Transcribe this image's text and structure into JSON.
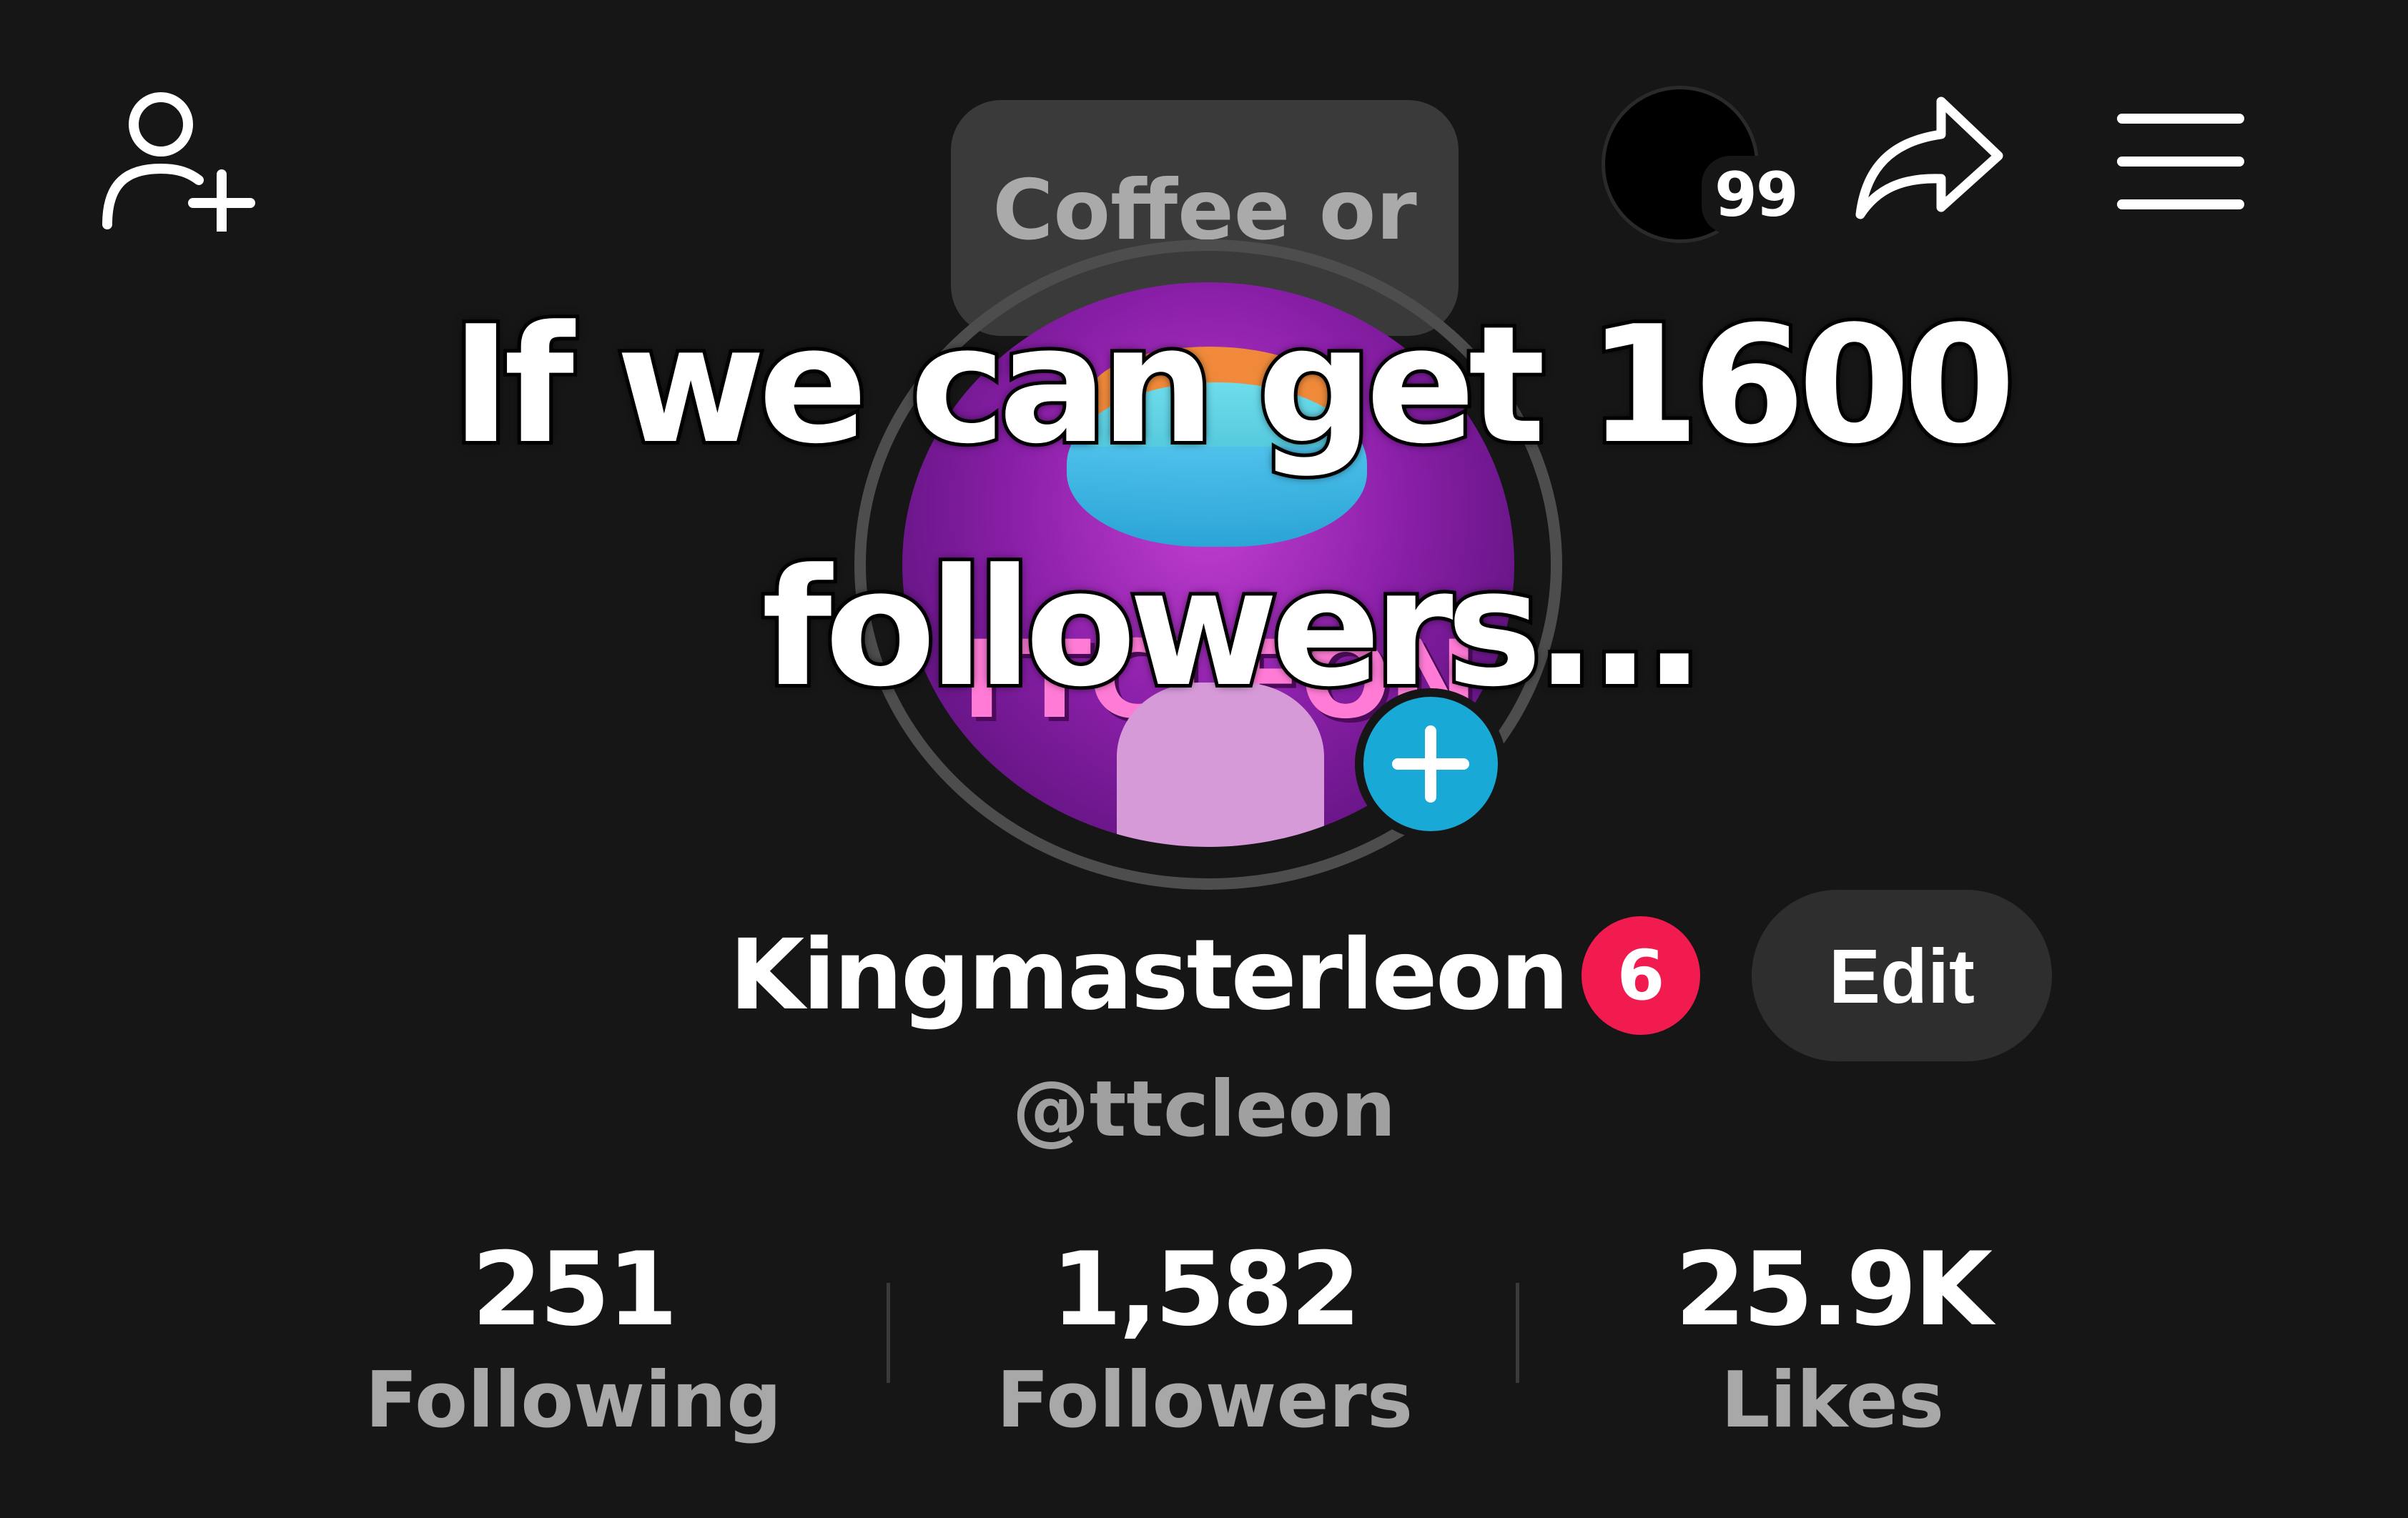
{
  "header": {
    "add_friend_icon": "add-friend-icon",
    "story_count": "99",
    "share_icon": "share-icon",
    "menu_icon": "hamburger-menu-icon"
  },
  "note": {
    "text": "Coffee or tea?"
  },
  "overlay_caption": {
    "line1": "If we can get 1600",
    "line2": "followers..."
  },
  "avatar": {
    "logo_text": "TTCLEON",
    "add_icon": "plus-icon"
  },
  "profile": {
    "display_name": "Kingmasterleon",
    "badge_count": "6",
    "edit_label": "Edit",
    "username": "@ttcleon"
  },
  "stats": {
    "following": {
      "value": "251",
      "label": "Following"
    },
    "followers": {
      "value": "1,582",
      "label": "Followers"
    },
    "likes": {
      "value": "25.9K",
      "label": "Likes"
    }
  },
  "colors": {
    "background": "#161616",
    "accent_blue": "#19a9d6",
    "badge_red": "#f21b4f",
    "muted_text": "#a8a8a8"
  }
}
